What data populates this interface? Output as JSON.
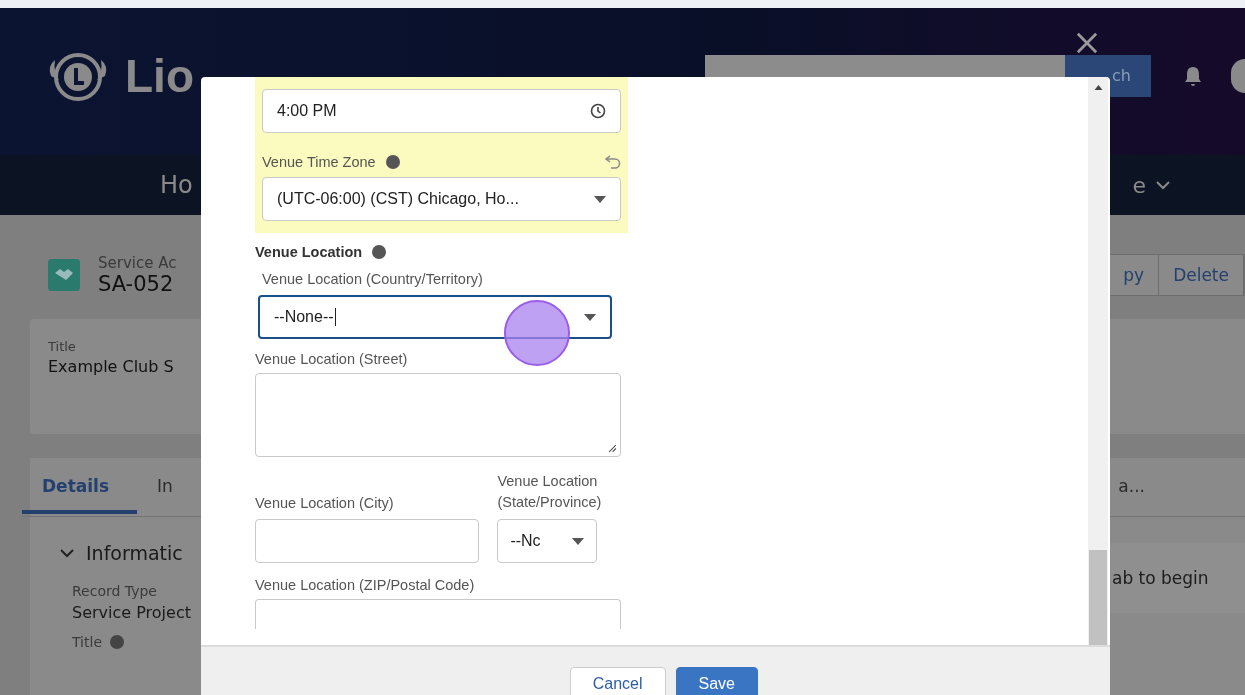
{
  "header": {
    "brand": "Lio",
    "search_button": "ch"
  },
  "nav": {
    "left_item": "Ho",
    "right_item": "e"
  },
  "record": {
    "type_label": "Service Ac",
    "number": "SA-052",
    "actions": [
      "py",
      "Delete"
    ]
  },
  "highlights": {
    "label": "Title",
    "value": "Example Club S"
  },
  "tabs": [
    {
      "label": "Details",
      "selected": true
    },
    {
      "label": "In",
      "selected": false
    }
  ],
  "tabs_right": "a...",
  "section": {
    "title": "Informatic",
    "expanded": true,
    "fields": [
      {
        "label": "Record Type",
        "value": "Service Project"
      },
      {
        "label": "Title",
        "info": true
      }
    ]
  },
  "side_panel": {
    "text": "ab to begin"
  },
  "modal": {
    "time_field": {
      "value": "4:00 PM",
      "highlighted": true
    },
    "time_zone": {
      "label": "Venue Time Zone",
      "value": "(UTC-06:00) (CST) Chicago, Ho...",
      "highlighted": true,
      "changed": true
    },
    "location_heading": "Venue Location",
    "country": {
      "label": "Venue Location (Country/Territory)",
      "value": "--None--",
      "focused": true
    },
    "street": {
      "label": "Venue Location (Street)"
    },
    "city": {
      "label": "Venue Location (City)"
    },
    "state": {
      "label": "Venue Location (State/Province)",
      "value": "--Nc"
    },
    "zip": {
      "label": "Venue Location (ZIP/Postal Code)"
    },
    "buttons": [
      "Cancel",
      "Save"
    ]
  }
}
